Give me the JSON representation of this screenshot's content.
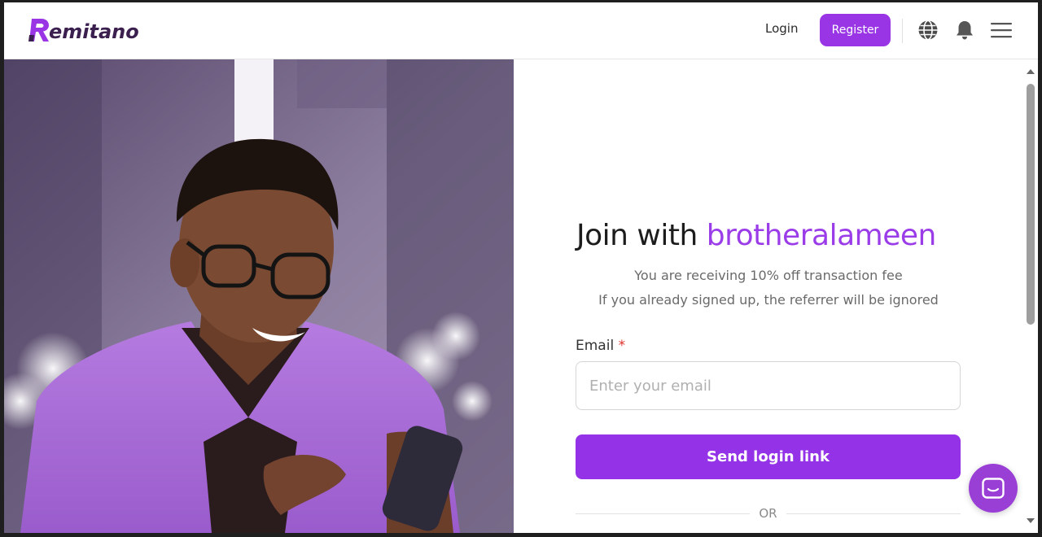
{
  "brand": {
    "name": "emitano",
    "accent": "#9a35e6"
  },
  "nav": {
    "login_label": "Login",
    "register_label": "Register",
    "icons": [
      "globe-icon",
      "bell-icon",
      "menu-icon"
    ]
  },
  "signup": {
    "title_prefix": "Join with ",
    "referrer": "brotheralameen",
    "line1": "You are receiving 10% off transaction fee",
    "line2": "If you already signed up, the referrer will be ignored",
    "email_label": "Email",
    "required_mark": "*",
    "email_placeholder": "Enter your email",
    "email_value": "",
    "send_button": "Send login link",
    "or_text": "OR"
  },
  "chat": {
    "icon": "chat-icon"
  }
}
